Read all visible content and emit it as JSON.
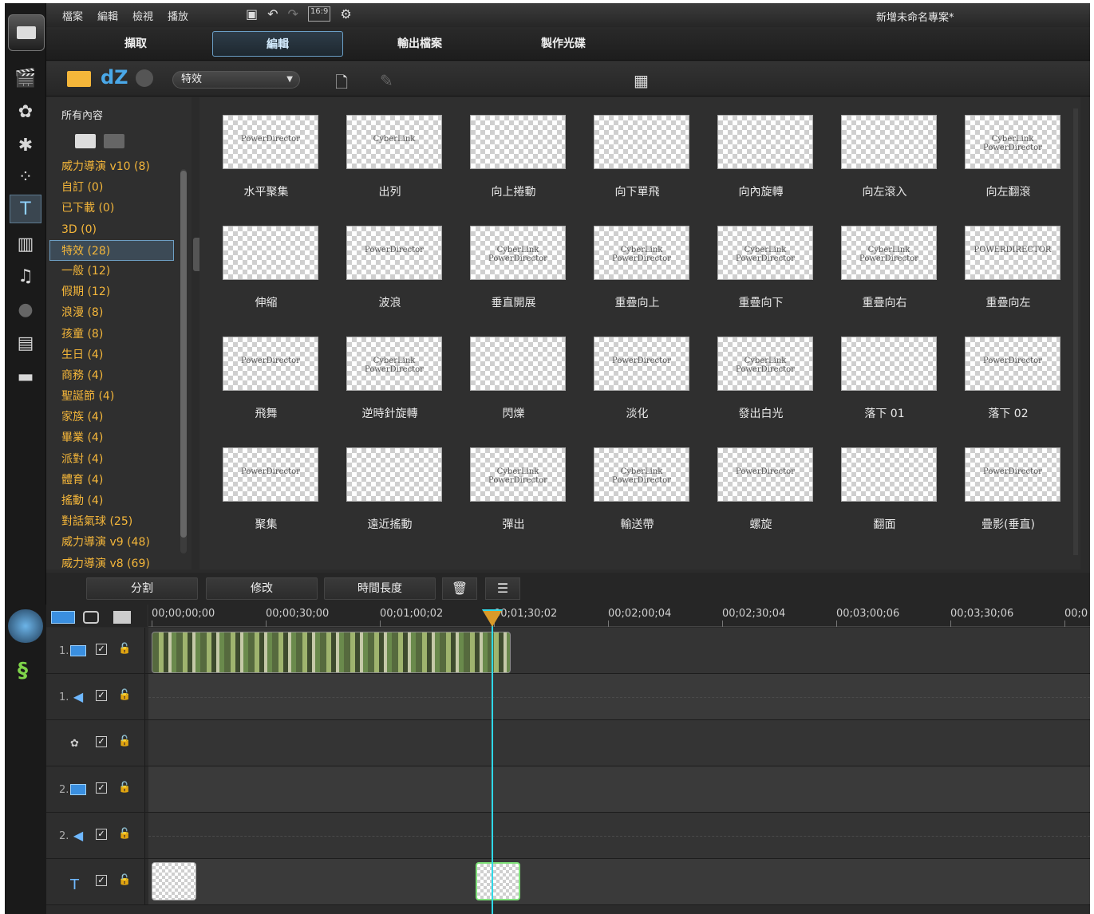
{
  "menu": [
    "檔案",
    "編輯",
    "檢視",
    "播放"
  ],
  "toolbar": {
    "aspect": "16:9"
  },
  "project_title": "新增未命名專案*",
  "modes": [
    "擷取",
    "編輯",
    "輸出檔案",
    "製作光碟"
  ],
  "active_mode": "編輯",
  "library": {
    "dz_label": "dZ",
    "filter_select": "特效",
    "all_content": "所有內容",
    "categories": [
      "威力導演 v10  (8)",
      "自訂  (0)",
      "已下載  (0)",
      "3D  (0)",
      "特效  (28)",
      "一般  (12)",
      "假期  (12)",
      "浪漫  (8)",
      "孩童  (8)",
      "生日  (4)",
      "商務  (4)",
      "聖誕節  (4)",
      "家族  (4)",
      "畢業  (4)",
      "派對  (4)",
      "體育  (4)",
      "搖動  (4)",
      "對話氣球  (25)",
      "威力導演 v9  (48)",
      "威力導演 v8  (69)"
    ],
    "selected_category_index": 4
  },
  "effects": [
    {
      "label": "水平聚集",
      "sample": "PowerDirector"
    },
    {
      "label": "出列",
      "sample": "CyberLink"
    },
    {
      "label": "向上捲動",
      "sample": ""
    },
    {
      "label": "向下單飛",
      "sample": ""
    },
    {
      "label": "向內旋轉",
      "sample": ""
    },
    {
      "label": "向左滾入",
      "sample": ""
    },
    {
      "label": "向左翻滾",
      "sample": "CyberLink PowerDirector"
    },
    {
      "label": "伸縮",
      "sample": ""
    },
    {
      "label": "波浪",
      "sample": "PowerDirector"
    },
    {
      "label": "垂直開展",
      "sample": "CyberLink PowerDirector"
    },
    {
      "label": "重疊向上",
      "sample": "CyberLink PowerDirector"
    },
    {
      "label": "重疊向下",
      "sample": "CyberLink PowerDirector"
    },
    {
      "label": "重疊向右",
      "sample": "CyberLink PowerDirector"
    },
    {
      "label": "重疊向左",
      "sample": "POWERDIRECTOR"
    },
    {
      "label": "飛舞",
      "sample": "PowerDirector"
    },
    {
      "label": "逆時針旋轉",
      "sample": "CyberLink PowerDirector"
    },
    {
      "label": "閃爍",
      "sample": ""
    },
    {
      "label": "淡化",
      "sample": "PowerDirector"
    },
    {
      "label": "發出白光",
      "sample": "CyberLink PowerDirector"
    },
    {
      "label": "落下 01",
      "sample": ""
    },
    {
      "label": "落下 02",
      "sample": "PowerDirector"
    },
    {
      "label": "聚集",
      "sample": "PowerDirector"
    },
    {
      "label": "遠近搖動",
      "sample": ""
    },
    {
      "label": "彈出",
      "sample": "CyberLink PowerDirector"
    },
    {
      "label": "輸送帶",
      "sample": "CyberLink PowerDirector"
    },
    {
      "label": "螺旋",
      "sample": "PowerDirector"
    },
    {
      "label": "翻面",
      "sample": ""
    },
    {
      "label": "疊影(垂直)",
      "sample": "PowerDirector"
    }
  ],
  "timeline": {
    "buttons": {
      "split": "分割",
      "modify": "修改",
      "duration": "時間長度"
    },
    "ruler": [
      "00;00;00;00",
      "00;00;30;00",
      "00;01;00;02",
      "00;01;30;02",
      "00;02;00;04",
      "00;02;30;04",
      "00;03;00;06",
      "00;03;30;06",
      "00;0"
    ],
    "tracks": [
      {
        "num": "1.",
        "type": "video"
      },
      {
        "num": "1.",
        "type": "audio"
      },
      {
        "num": "",
        "type": "effect"
      },
      {
        "num": "2.",
        "type": "video"
      },
      {
        "num": "2.",
        "type": "audio"
      },
      {
        "num": "",
        "type": "title"
      }
    ]
  }
}
